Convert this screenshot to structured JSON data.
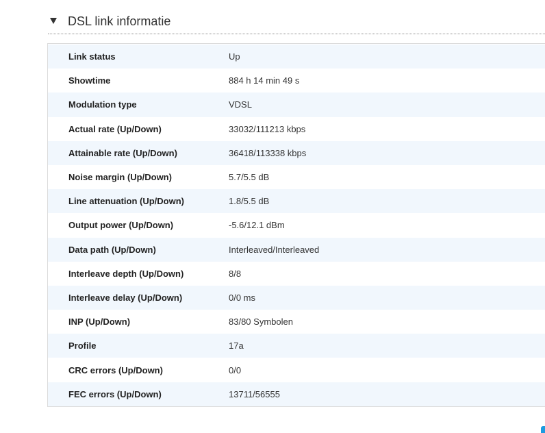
{
  "section": {
    "title": "DSL link informatie",
    "toggle_icon": "triangle-down-icon"
  },
  "table": {
    "rows": [
      {
        "label": "Link status",
        "value": "Up"
      },
      {
        "label": "Showtime",
        "value": "884 h 14 min 49 s"
      },
      {
        "label": "Modulation type",
        "value": "VDSL"
      },
      {
        "label": "Actual rate (Up/Down)",
        "value": "33032/111213 kbps"
      },
      {
        "label": "Attainable rate (Up/Down)",
        "value": "36418/113338 kbps"
      },
      {
        "label": "Noise margin (Up/Down)",
        "value": "5.7/5.5 dB"
      },
      {
        "label": "Line attenuation (Up/Down)",
        "value": "1.8/5.5 dB"
      },
      {
        "label": "Output power (Up/Down)",
        "value": "-5.6/12.1 dBm"
      },
      {
        "label": "Data path (Up/Down)",
        "value": "Interleaved/Interleaved"
      },
      {
        "label": "Interleave depth (Up/Down)",
        "value": "8/8"
      },
      {
        "label": "Interleave delay (Up/Down)",
        "value": "0/0 ms"
      },
      {
        "label": "INP (Up/Down)",
        "value": "83/80 Symbolen"
      },
      {
        "label": "Profile",
        "value": "17a"
      },
      {
        "label": "CRC errors (Up/Down)",
        "value": "0/0"
      },
      {
        "label": "FEC errors (Up/Down)",
        "value": "13711/56555"
      }
    ]
  },
  "colors": {
    "row_alt": "#f1f7fd",
    "accent": "#1e9be0"
  }
}
